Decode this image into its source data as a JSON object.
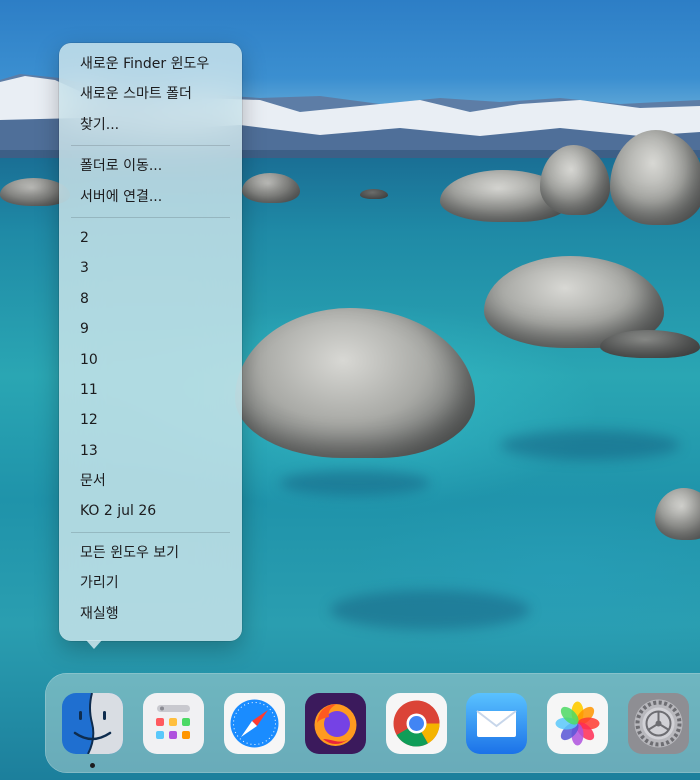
{
  "menu": {
    "sections": [
      {
        "items": [
          "새로운 Finder 윈도우",
          "새로운 스마트 폴더",
          "찾기..."
        ]
      },
      {
        "items": [
          "폴더로 이동...",
          "서버에 연결..."
        ]
      },
      {
        "items": [
          "2",
          "3",
          "8",
          "9",
          "10",
          "11",
          "12",
          "13",
          "문서",
          "KO 2 jul 26"
        ]
      },
      {
        "items": [
          "모든 윈도우 보기",
          "가리기",
          "재실행"
        ]
      }
    ]
  },
  "dock": {
    "apps": [
      {
        "name": "finder-icon",
        "running": true
      },
      {
        "name": "launchpad-icon",
        "running": false
      },
      {
        "name": "safari-icon",
        "running": false
      },
      {
        "name": "firefox-icon",
        "running": false
      },
      {
        "name": "chrome-icon",
        "running": false
      },
      {
        "name": "mail-icon",
        "running": false
      },
      {
        "name": "photos-icon",
        "running": false
      },
      {
        "name": "system-settings-icon",
        "running": false
      }
    ]
  }
}
